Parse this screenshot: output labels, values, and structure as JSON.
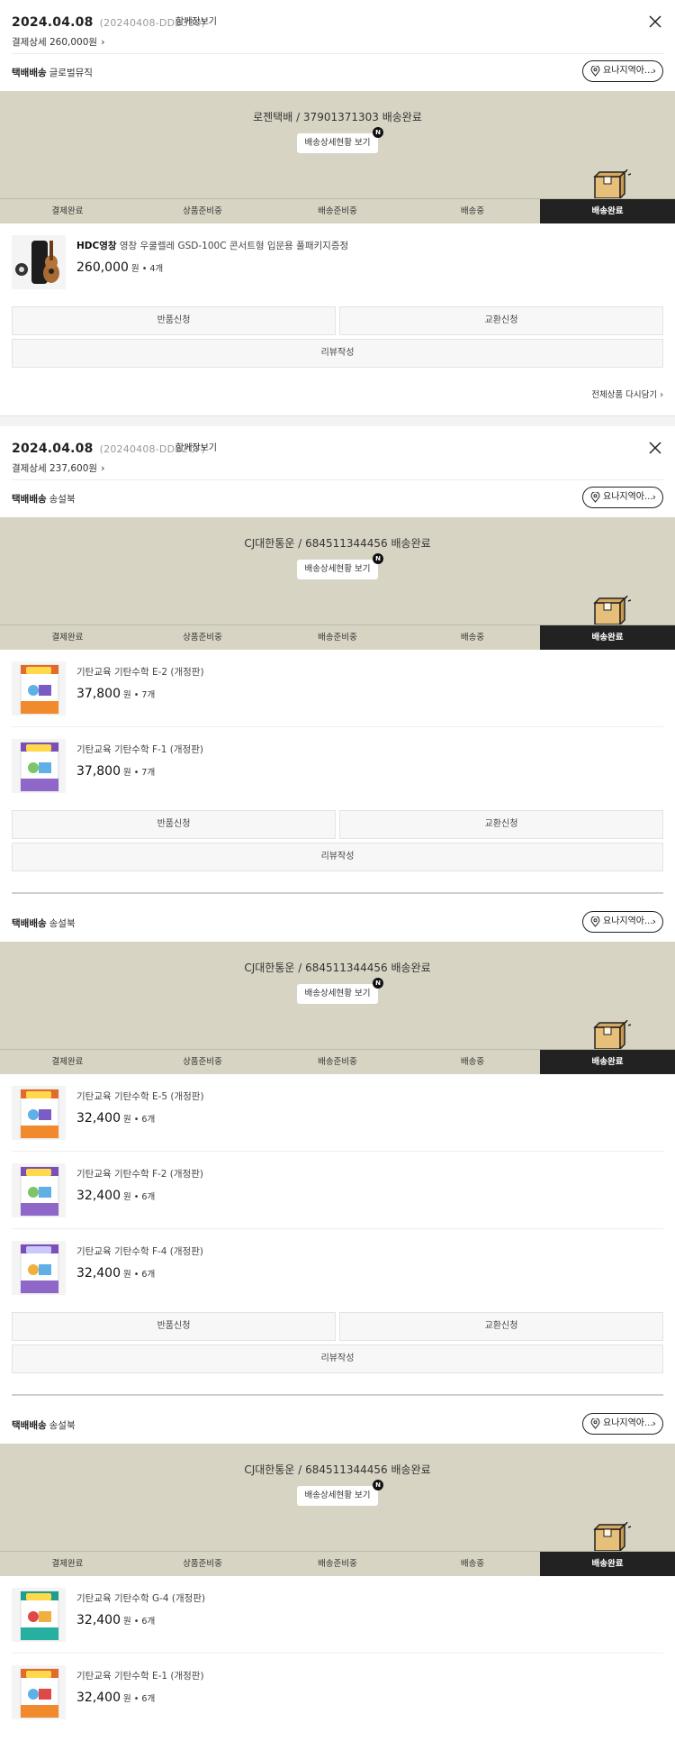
{
  "common": {
    "share_label": "함께장보기",
    "pay_prefix": "결제상세",
    "ship_type_label": "택배배송",
    "location_label": "요나지역아...",
    "track_button": "배송상세현황 보기",
    "badge_new": "N",
    "steps": [
      "결제완료",
      "상품준비중",
      "배송준비중",
      "배송중",
      "배송완료"
    ],
    "return_label": "반품신청",
    "exchange_label": "교환신청",
    "review_label": "리뷰작성",
    "reorder_label": "전체상품 다시담기",
    "price_unit": "원",
    "dot": "•"
  },
  "orders": [
    {
      "date": "2024.04.08",
      "order_no": "(20240408-DDB330)",
      "pay_amount": "260,000원",
      "seller": "글로벌뮤직",
      "tracking": "로젠택배 / 37901371303 배송완료",
      "products": [
        {
          "brand": "HDC영창",
          "name": " 영창 우쿨렐레 GSD-100C 콘서트형 입문용 풀패키지증정",
          "price": "260,000",
          "qty": "4개"
        }
      ]
    },
    {
      "date": "2024.04.08",
      "order_no": "(20240408-DDB2CF)",
      "pay_amount": "237,600원",
      "shipments": [
        {
          "seller": "송설북",
          "tracking": "CJ대한통운 / 684511344456 배송완료",
          "products": [
            {
              "name": "기탄교육 기탄수학 E-2 (개정판)",
              "price": "37,800",
              "qty": "7개"
            },
            {
              "name": "기탄교육 기탄수학 F-1 (개정판)",
              "price": "37,800",
              "qty": "7개"
            }
          ]
        },
        {
          "seller": "송설북",
          "tracking": "CJ대한통운 / 684511344456 배송완료",
          "products": [
            {
              "name": "기탄교육 기탄수학 E-5 (개정판)",
              "price": "32,400",
              "qty": "6개"
            },
            {
              "name": "기탄교육 기탄수학 F-2 (개정판)",
              "price": "32,400",
              "qty": "6개"
            },
            {
              "name": "기탄교육 기탄수학 F-4 (개정판)",
              "price": "32,400",
              "qty": "6개"
            }
          ]
        },
        {
          "seller": "송설북",
          "tracking": "CJ대한통운 / 684511344456 배송완료",
          "products": [
            {
              "name": "기탄교육 기탄수학 G-4 (개정판)",
              "price": "32,400",
              "qty": "6개"
            },
            {
              "name": "기탄교육 기탄수학 E-1 (개정판)",
              "price": "32,400",
              "qty": "6개"
            }
          ]
        }
      ]
    }
  ]
}
